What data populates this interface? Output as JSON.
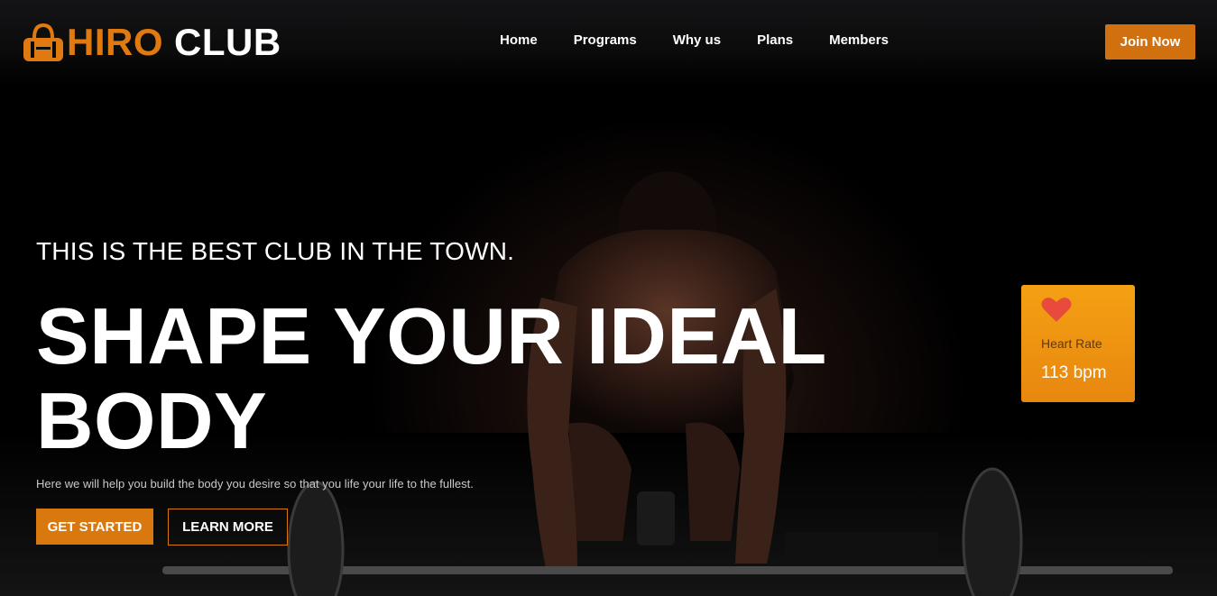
{
  "brand": {
    "name_part1": "HIRO",
    "name_part2": "CLUB",
    "icon": "gym-bag-icon",
    "accent_color": "#e07a10"
  },
  "nav": {
    "items": [
      {
        "label": "Home"
      },
      {
        "label": "Programs"
      },
      {
        "label": "Why us"
      },
      {
        "label": "Plans"
      },
      {
        "label": "Members"
      }
    ],
    "cta": "Join Now"
  },
  "hero": {
    "tagline": "THIS IS THE BEST CLUB IN THE TOWN.",
    "headline_line1": "SHAPE YOUR IDEAL",
    "headline_line2": "BODY",
    "subtext": "Here we will help you build the body you desire so that you life your life to the fullest.",
    "primary_button": "GET STARTED",
    "secondary_button": "LEARN MORE"
  },
  "heart_rate_card": {
    "icon": "heart-icon",
    "label": "Heart Rate",
    "value": "113 bpm",
    "background": "#f19a12"
  }
}
